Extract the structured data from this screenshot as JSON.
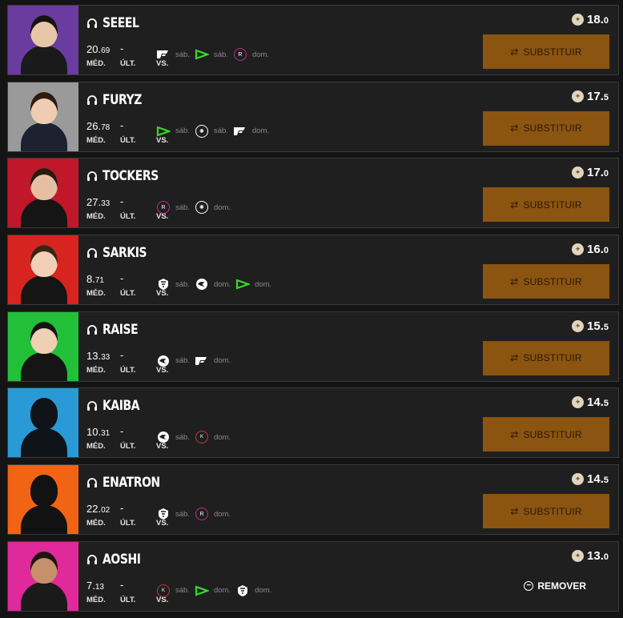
{
  "labels": {
    "med": "MÉD.",
    "ult": "ÚLT.",
    "vs": "VS.",
    "last_placeholder": "-",
    "substitute": "SUBSTITUIR",
    "remove": "REMOVER"
  },
  "players": [
    {
      "name": "SEEEL",
      "avg_int": "20.",
      "avg_dec": "69",
      "price_int": "18.",
      "price_dec": "0",
      "bg": "#6a3ca0",
      "skin": "#e8c7a8",
      "shirt": "#1a1a1a",
      "hair": "#141414",
      "action": "substitute",
      "matches": [
        {
          "logo": "paiN",
          "day": "sáb."
        },
        {
          "logo": "LOUD",
          "day": "sáb."
        },
        {
          "logo": "RED",
          "day": "dom."
        }
      ]
    },
    {
      "name": "FURYZ",
      "avg_int": "26.",
      "avg_dec": "78",
      "price_int": "17.",
      "price_dec": "5",
      "bg": "#9a9a9a",
      "skin": "#f0cdb2",
      "shirt": "#1c2230",
      "hair": "#2e1c10",
      "action": "substitute",
      "matches": [
        {
          "logo": "LOUD",
          "day": "sáb."
        },
        {
          "logo": "LIBERTY",
          "day": "sáb."
        },
        {
          "logo": "paiN",
          "day": "dom."
        }
      ]
    },
    {
      "name": "TOCKERS",
      "avg_int": "27.",
      "avg_dec": "33",
      "price_int": "17.",
      "price_dec": "0",
      "bg": "#c0182a",
      "skin": "#e6bfa2",
      "shirt": "#151515",
      "hair": "#2a1a10",
      "action": "substitute",
      "matches": [
        {
          "logo": "RED",
          "day": "sáb."
        },
        {
          "logo": "LIBERTY",
          "day": "dom."
        }
      ]
    },
    {
      "name": "SARKIS",
      "avg_int": "8.",
      "avg_dec": "71",
      "price_int": "16.",
      "price_dec": "0",
      "bg": "#d8241e",
      "skin": "#f2cfb6",
      "shirt": "#151515",
      "hair": "#3a2416",
      "action": "substitute",
      "matches": [
        {
          "logo": "INTZ",
          "day": "sáb."
        },
        {
          "logo": "FURIA",
          "day": "dom."
        },
        {
          "logo": "LOUD",
          "day": "dom."
        }
      ]
    },
    {
      "name": "RAISE",
      "avg_int": "13.",
      "avg_dec": "33",
      "price_int": "15.",
      "price_dec": "5",
      "bg": "#22c038",
      "skin": "#f0d0b4",
      "shirt": "#151515",
      "hair": "#141414",
      "action": "substitute",
      "matches": [
        {
          "logo": "FURIA",
          "day": "sáb."
        },
        {
          "logo": "paiN",
          "day": "dom."
        }
      ]
    },
    {
      "name": "KAIBA",
      "avg_int": "10.",
      "avg_dec": "31",
      "price_int": "14.",
      "price_dec": "5",
      "bg": "#2a9ad6",
      "skin": "#101418",
      "shirt": "#101418",
      "hair": "#101418",
      "action": "substitute",
      "matches": [
        {
          "logo": "FURIA",
          "day": "sáb."
        },
        {
          "logo": "KBM",
          "day": "dom."
        }
      ]
    },
    {
      "name": "ENATRON",
      "avg_int": "22.",
      "avg_dec": "02",
      "price_int": "14.",
      "price_dec": "5",
      "bg": "#f06414",
      "skin": "#121212",
      "shirt": "#121212",
      "hair": "#121212",
      "action": "substitute",
      "matches": [
        {
          "logo": "INTZ",
          "day": "sáb."
        },
        {
          "logo": "RED",
          "day": "dom."
        }
      ]
    },
    {
      "name": "AOSHI",
      "avg_int": "7.",
      "avg_dec": "13",
      "price_int": "13.",
      "price_dec": "0",
      "bg": "#e0299a",
      "skin": "#c6906a",
      "shirt": "#1a1a1a",
      "hair": "#1e1410",
      "action": "remove",
      "matches": [
        {
          "logo": "KBM",
          "day": "sáb."
        },
        {
          "logo": "LOUD",
          "day": "dom."
        },
        {
          "logo": "INTZ",
          "day": "dom."
        }
      ]
    }
  ]
}
